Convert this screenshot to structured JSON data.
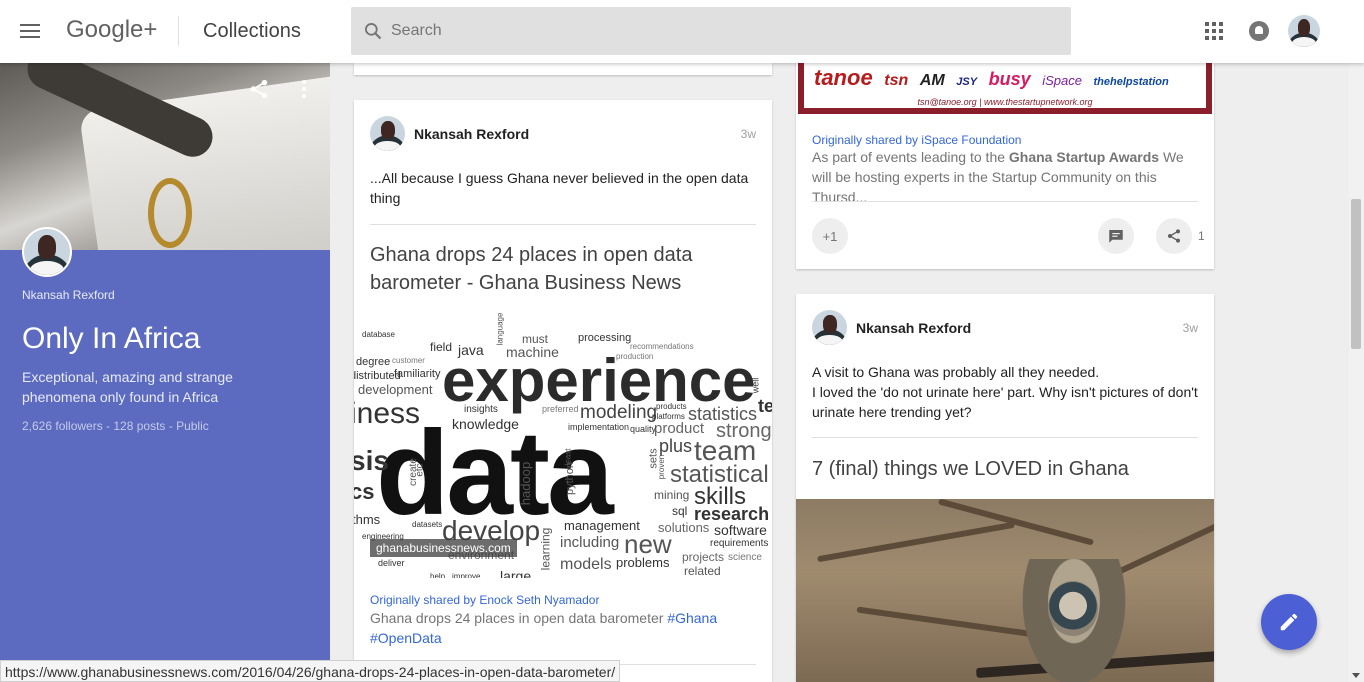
{
  "header": {
    "logo": "Google+",
    "section": "Collections",
    "search_placeholder": "Search"
  },
  "collection": {
    "owner": "Nkansah Rexford",
    "title": "Only In Africa",
    "description": "Exceptional, amazing and strange phenomena only found in Africa",
    "stats": "2,626 followers - 128 posts - Public"
  },
  "post1": {
    "author": "Nkansah Rexford",
    "time": "3w",
    "text": "...All because I guess Ghana never believed in the open data thing",
    "link_title": "Ghana drops 24 places in open data barometer - Ghana Business News",
    "image_caption": "ghanabusinessnews.com",
    "shared_by": "Originally shared by Enock Seth Nyamador",
    "shared_text": "Ghana drops 24 places in open data barometer ",
    "hashtag1": "#Ghana",
    "hashtag2": "#OpenData"
  },
  "wordcloud": {
    "words": [
      "experience",
      "data",
      "develop",
      "knowledge",
      "modeling",
      "statistics",
      "team",
      "strong",
      "plus",
      "product",
      "statistical",
      "skills",
      "research",
      "software",
      "management",
      "including",
      "new",
      "problems",
      "models",
      "related",
      "projects",
      "science",
      "solutions",
      "requirements",
      "mining",
      "sql",
      "field",
      "java",
      "machine",
      "must",
      "processing",
      "degree",
      "familiarity",
      "development",
      "insights",
      "implementation",
      "quality",
      "platforms",
      "products",
      "preferred",
      "recommendations",
      "production",
      "customer",
      "distributed",
      "iness",
      "sis",
      "cs",
      "thms",
      "database",
      "datasets",
      "engineering",
      "hadoop",
      "python",
      "create",
      "etc",
      "least",
      "proven",
      "sets",
      "language",
      "learning",
      "large",
      "environment",
      "deliver",
      "help",
      "improve",
      "well",
      "te"
    ]
  },
  "post2": {
    "banner_logos": [
      "tanoe",
      "tsn",
      "AM",
      "JSY",
      "busy",
      "iSpace",
      "thehelpstation"
    ],
    "banner_sub": "tsn@tanoe.org | www.thestartupnetwork.org",
    "shared_by": "Originally shared by iSpace Foundation",
    "text_pre": "As part of events leading to the ",
    "text_bold": "Ghana Startup Awards",
    "text_post": " We will be hosting experts in the Startup Community on this Thursd...",
    "plus_one": "+1",
    "share_count": "1"
  },
  "post3": {
    "author": "Nkansah Rexford",
    "time": "3w",
    "text_line1": "A visit to Ghana was probably all they needed.",
    "text_line2": "I loved the 'do not urinate here' part. Why isn't pictures of don't urinate here trending yet?",
    "link_title": "7 (final) things we LOVED in Ghana"
  },
  "status_url": "https://www.ghanabusinessnews.com/2016/04/26/ghana-drops-24-places-in-open-data-barometer/",
  "colors": {
    "accent": "#5c6bc0",
    "fab": "#4c5fd5",
    "link": "#3367d6",
    "banner_border": "#8b1e2b"
  }
}
